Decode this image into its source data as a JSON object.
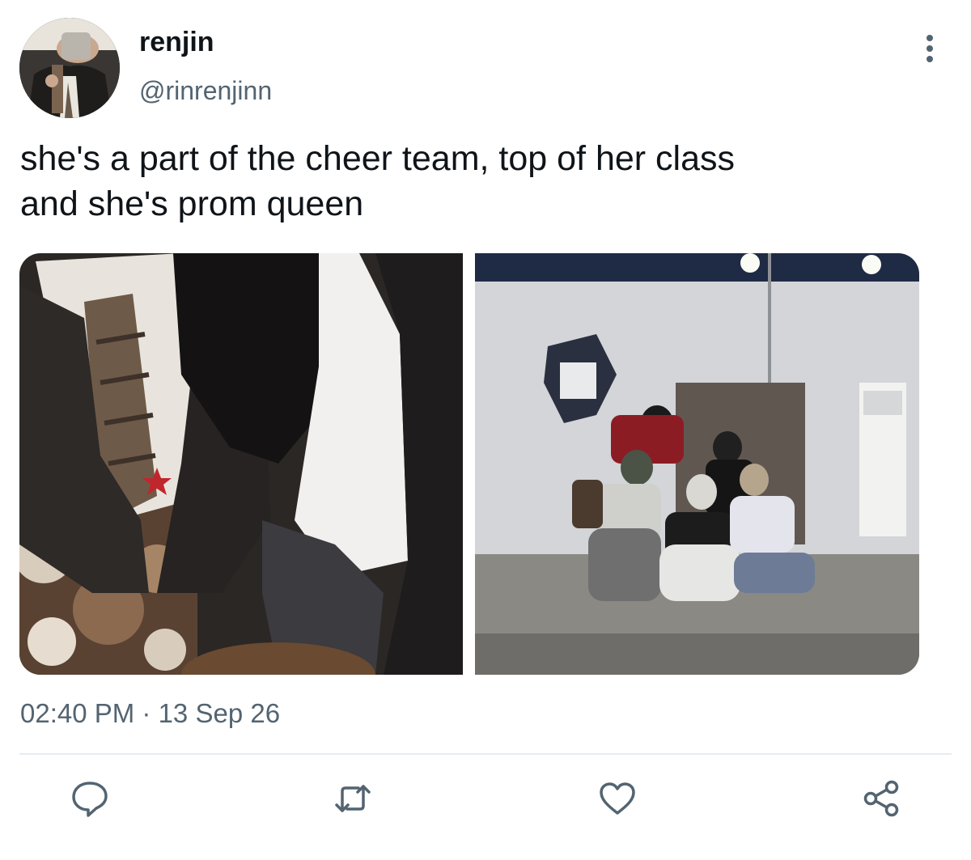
{
  "author": {
    "display_name": "renjin",
    "handle": "@rinrenjinn",
    "avatar_icon": "profile-photo"
  },
  "tweet": {
    "text_line1": "she's a part of the cheer team, top of her class",
    "text_line2": "and she's prom queen",
    "timestamp": "02:40 PM · 13 Sep 26"
  },
  "media": [
    {
      "alt": "photo-outfit-closeup"
    },
    {
      "alt": "photo-dance-studio-mirror-group"
    }
  ],
  "actions": [
    {
      "name": "reply",
      "icon": "speech-bubble-icon"
    },
    {
      "name": "retweet",
      "icon": "retweet-arrows-icon"
    },
    {
      "name": "like",
      "icon": "heart-icon"
    },
    {
      "name": "share",
      "icon": "share-nodes-icon"
    }
  ],
  "colors": {
    "text_primary": "#0f1419",
    "text_secondary": "#536471",
    "icon": "#536471",
    "divider": "#e6ecf0"
  }
}
